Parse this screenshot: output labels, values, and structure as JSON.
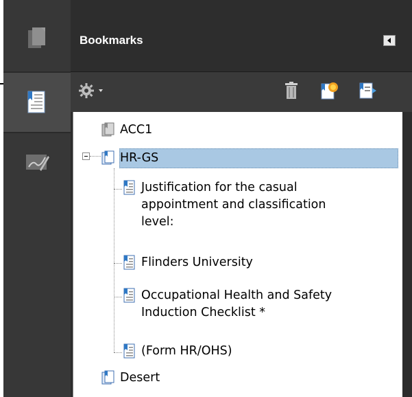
{
  "panel": {
    "title": "Bookmarks"
  },
  "rail": {
    "items": [
      {
        "name": "pages-icon",
        "active": false
      },
      {
        "name": "bookmarks-icon",
        "active": true
      },
      {
        "name": "signatures-icon",
        "active": false
      }
    ]
  },
  "toolbar": {
    "options": "options-gear-icon",
    "delete": "trash-icon",
    "new": "new-bookmark-icon",
    "expand": "expand-bookmark-icon"
  },
  "bookmarks": {
    "acc1": "ACC1",
    "hrgs": "HR-GS",
    "child1_line1": "Justification for the casual",
    "child1_line2": "appointment and classification",
    "child1_line3": "level:",
    "child2": "Flinders University",
    "child3_line1": "Occupational Health and Safety",
    "child3_line2": "Induction Checklist *",
    "child4": "(Form HR/OHS)",
    "desert": "Desert"
  }
}
